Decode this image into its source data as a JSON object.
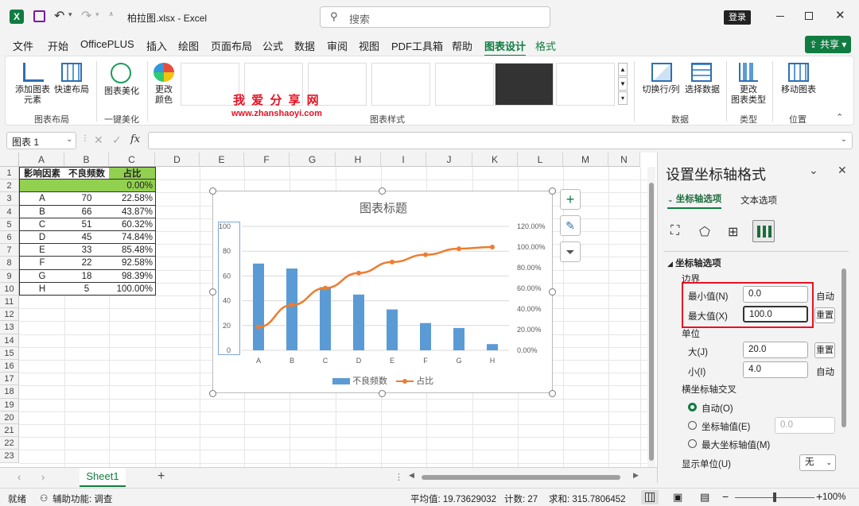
{
  "titlebar": {
    "filename": "柏拉图.xlsx",
    "sep": "-",
    "app": "Excel",
    "search_placeholder": "搜索",
    "login": "登录"
  },
  "menu": [
    {
      "label": "文件"
    },
    {
      "label": "开始"
    },
    {
      "label": "OfficePLUS"
    },
    {
      "label": "插入"
    },
    {
      "label": "绘图"
    },
    {
      "label": "页面布局"
    },
    {
      "label": "公式"
    },
    {
      "label": "数据"
    },
    {
      "label": "审阅"
    },
    {
      "label": "视图"
    },
    {
      "label": "PDF工具箱"
    },
    {
      "label": "帮助"
    },
    {
      "label": "图表设计"
    },
    {
      "label": "格式"
    }
  ],
  "share": "共享",
  "ribbon": {
    "add_element": "添加图表\n元素",
    "quick_layout": "快速布局",
    "beautify": "图表美化",
    "change_colors": "更改\n颜色",
    "switch_row_col": "切换行/列",
    "select_data": "选择数据",
    "change_type": "更改\n图表类型",
    "move_chart": "移动图表",
    "groups": {
      "layout": "图表布局",
      "beauty": "一键美化",
      "styles": "图表样式",
      "data": "数据",
      "type": "类型",
      "location": "位置"
    },
    "watermark_cn": "我 爱 分 享 网",
    "watermark_url": "www.zhanshaoyi.com"
  },
  "formula": {
    "namebox": "图表 1",
    "fx": "fx"
  },
  "columns": [
    "A",
    "B",
    "C",
    "D",
    "E",
    "F",
    "G",
    "H",
    "I",
    "J",
    "K",
    "L",
    "M",
    "N"
  ],
  "rows": [
    "1",
    "2",
    "3",
    "4",
    "5",
    "6",
    "7",
    "8",
    "9",
    "10",
    "11",
    "12",
    "13",
    "14",
    "15",
    "16",
    "17",
    "18",
    "19",
    "20",
    "21",
    "22",
    "23"
  ],
  "table": {
    "headers": [
      "影响因素",
      "不良频数",
      "占比"
    ],
    "row2": [
      "",
      "",
      "0.00%"
    ],
    "data": [
      [
        "A",
        "70",
        "22.58%"
      ],
      [
        "B",
        "66",
        "43.87%"
      ],
      [
        "C",
        "51",
        "60.32%"
      ],
      [
        "D",
        "45",
        "74.84%"
      ],
      [
        "E",
        "33",
        "85.48%"
      ],
      [
        "F",
        "22",
        "92.58%"
      ],
      [
        "G",
        "18",
        "98.39%"
      ],
      [
        "H",
        "5",
        "100.00%"
      ]
    ]
  },
  "chart_data": {
    "type": "bar",
    "title": "图表标题",
    "categories": [
      "A",
      "B",
      "C",
      "D",
      "E",
      "F",
      "G",
      "H"
    ],
    "series": [
      {
        "name": "不良频数",
        "type": "bar",
        "values": [
          70,
          66,
          51,
          45,
          33,
          22,
          18,
          5
        ],
        "color": "#5b9bd5"
      },
      {
        "name": "占比",
        "type": "line",
        "values": [
          0.2258,
          0.4387,
          0.6032,
          0.7484,
          0.8548,
          0.9258,
          0.9839,
          1.0
        ],
        "color": "#ed7d31"
      }
    ],
    "ylim": [
      0,
      100
    ],
    "y_ticks": [
      "100",
      "80",
      "60",
      "40",
      "20",
      "0"
    ],
    "y2lim": [
      0,
      1.2
    ],
    "y2_ticks": [
      "120.00%",
      "100.00%",
      "80.00%",
      "60.00%",
      "40.00%",
      "20.00%",
      "0.00%"
    ],
    "legend": "bottom"
  },
  "pane": {
    "title": "设置坐标轴格式",
    "tab_axis": "坐标轴选项",
    "tab_text": "文本选项",
    "section": "坐标轴选项",
    "bounds": "边界",
    "min_label": "最小值(N)",
    "min_value": "0.0",
    "min_btn": "自动",
    "max_label": "最大值(X)",
    "max_value": "100.0",
    "max_btn": "重置",
    "units": "单位",
    "major_label": "大(J)",
    "major_value": "20.0",
    "major_btn": "重置",
    "minor_label": "小(I)",
    "minor_value": "4.0",
    "minor_btn": "自动",
    "cross": "横坐标轴交叉",
    "cross_auto": "自动(O)",
    "cross_value": "坐标轴值(E)",
    "cross_value_input": "0.0",
    "cross_max": "最大坐标轴值(M)",
    "display_unit": "显示单位(U)",
    "display_unit_value": "无"
  },
  "sheets": {
    "tab": "Sheet1",
    "add": "+"
  },
  "status": {
    "ready": "就绪",
    "accessibility": "辅助功能: 调查",
    "average": "平均值: 19.73629032",
    "count": "计数: 27",
    "sum": "求和: 315.7806452",
    "zoom": "100%"
  },
  "colors": {
    "accent": "#107c41",
    "bar": "#5b9bd5",
    "line": "#ed7d31",
    "header_green": "#92d050",
    "highlight": "#e81123"
  }
}
